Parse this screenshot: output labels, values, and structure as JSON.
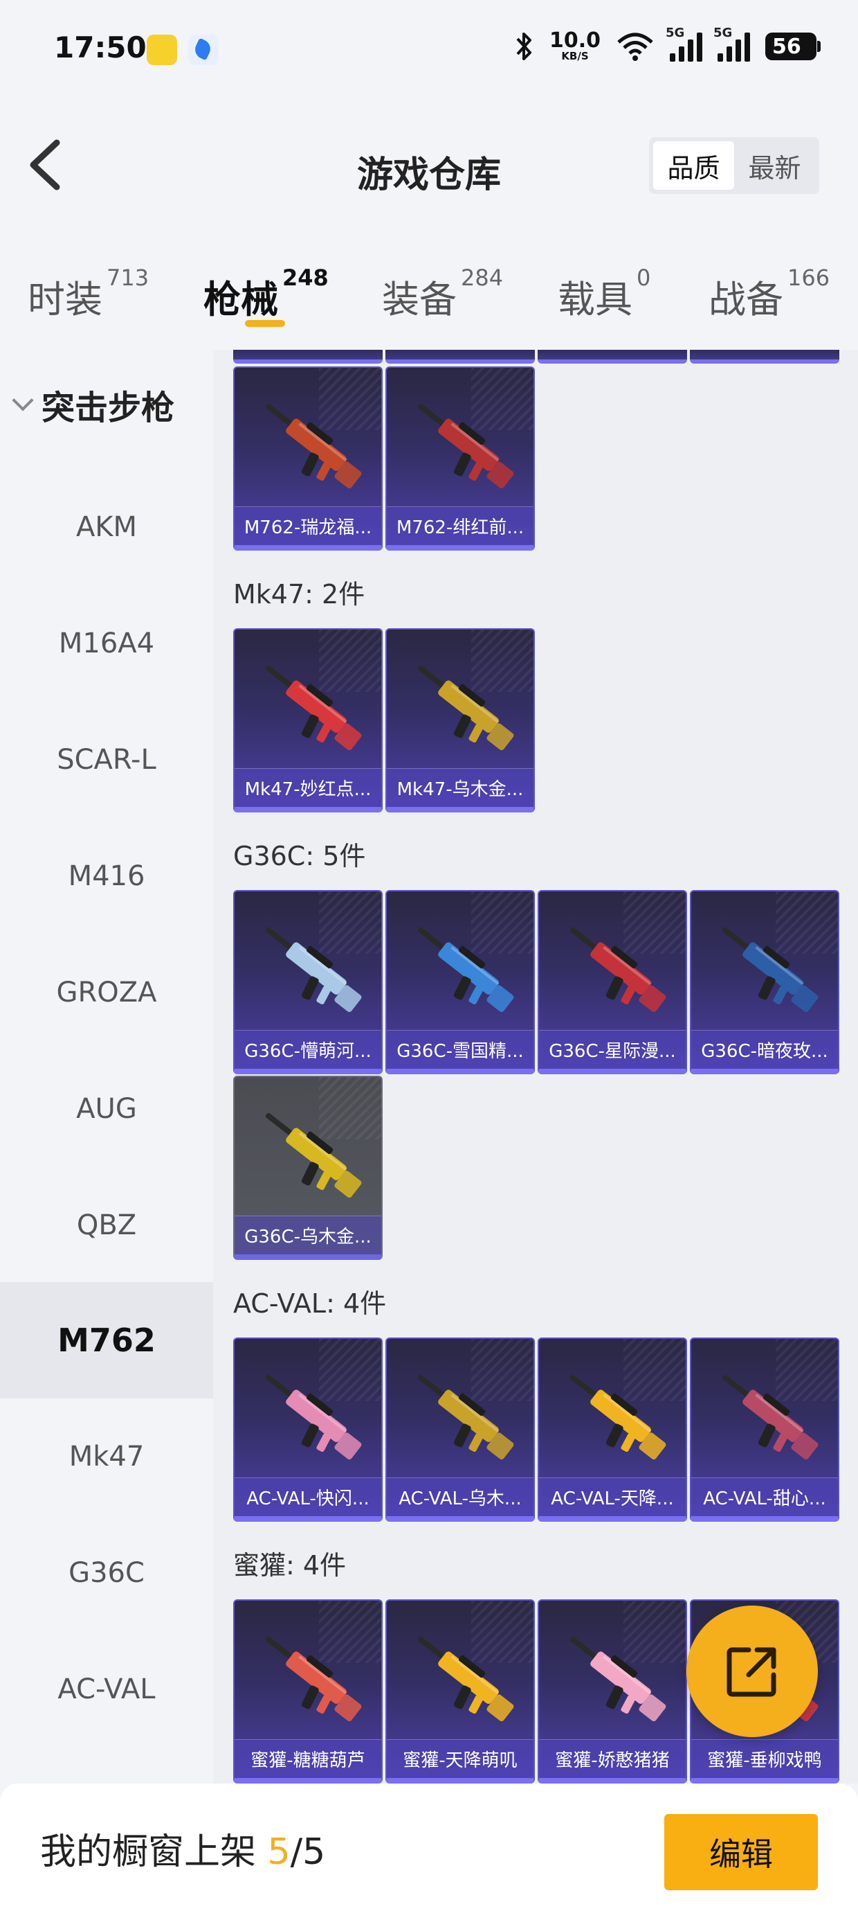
{
  "status_bar": {
    "time": "17:50",
    "net_speed_value": "10.0",
    "net_speed_unit": "KB/S",
    "signal1_label": "5G",
    "signal2_label": "5G",
    "battery": "56",
    "icons": [
      "bluetooth-icon",
      "wifi-icon",
      "signal-icon"
    ]
  },
  "header": {
    "title": "游戏仓库",
    "sort_options": [
      "品质",
      "最新"
    ],
    "sort_selected": "品质"
  },
  "tabs": [
    {
      "label": "时装",
      "count": "713"
    },
    {
      "label": "枪械",
      "count": "248"
    },
    {
      "label": "装备",
      "count": "284"
    },
    {
      "label": "载具",
      "count": "0"
    },
    {
      "label": "战备",
      "count": "166"
    }
  ],
  "active_tab": "枪械",
  "sidebar": {
    "category": "突击步枪",
    "items": [
      "AKM",
      "M16A4",
      "SCAR-L",
      "M416",
      "GROZA",
      "AUG",
      "QBZ",
      "M762",
      "Mk47",
      "G36C",
      "AC-VAL"
    ],
    "active_item": "M762"
  },
  "content": {
    "groups": [
      {
        "title": "",
        "items": [
          "M762-瑞龙福...",
          "M762-绯红前..."
        ]
      },
      {
        "title": "Mk47: 2件",
        "items": [
          "Mk47-妙红点...",
          "Mk47-乌木金..."
        ]
      },
      {
        "title": "G36C: 5件",
        "items": [
          "G36C-懵萌河...",
          "G36C-雪国精...",
          "G36C-星际漫...",
          "G36C-暗夜玫...",
          "G36C-乌木金..."
        ]
      },
      {
        "title": "AC-VAL: 4件",
        "items": [
          "AC-VAL-快闪...",
          "AC-VAL-乌木...",
          "AC-VAL-天降...",
          "AC-VAL-甜心..."
        ]
      },
      {
        "title": "蜜獾: 4件",
        "items": [
          "蜜獾-糖糖葫芦",
          "蜜獾-天降萌叽",
          "蜜獾-娇憨猪猪",
          "蜜獾-垂柳戏鸭"
        ]
      }
    ],
    "gun_colors": {
      "m762_1": "#c24a2a",
      "m762_2": "#b63434",
      "mk47_1": "#d8383c",
      "mk47_2": "#c9a22a",
      "g36c_1": "#a9c9e6",
      "g36c_2": "#3a86d8",
      "g36c_3": "#c6323a",
      "g36c_4": "#2c5fa8",
      "g36c_5": "#d8b820",
      "acval_1": "#e48cb4",
      "acval_2": "#c9a22a",
      "acval_3": "#f0b420",
      "acval_4": "#b84a66",
      "honey_1": "#e25a4a",
      "honey_2": "#f0b420",
      "honey_3": "#f2a8c4",
      "honey_4": "#d8383c"
    }
  },
  "bottom_bar": {
    "shelf_label": "我的橱窗上架",
    "shelf_current": "5",
    "shelf_separator": "/",
    "shelf_total": "5",
    "edit_label": "编辑"
  },
  "fab": {
    "icon": "share-external-icon"
  },
  "accent_color": "#f5ae1c"
}
